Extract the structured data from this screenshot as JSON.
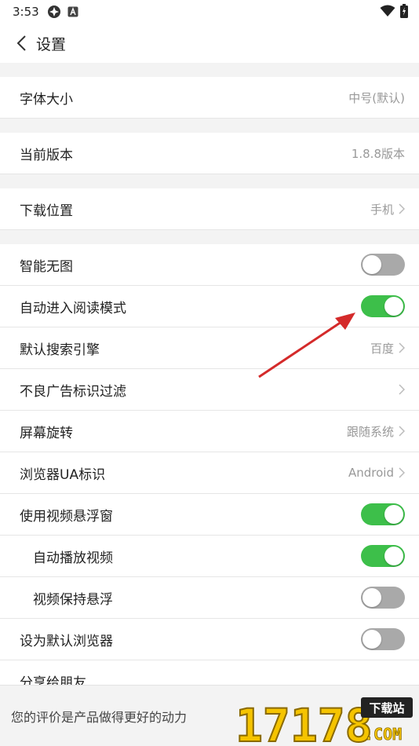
{
  "status_bar": {
    "time": "3:53"
  },
  "header": {
    "title": "设置"
  },
  "settings": {
    "font_size": {
      "label": "字体大小",
      "value": "中号(默认)"
    },
    "version": {
      "label": "当前版本",
      "value": "1.8.8版本"
    },
    "download_location": {
      "label": "下载位置",
      "value": "手机"
    },
    "smart_no_image": {
      "label": "智能无图",
      "toggle": "off"
    },
    "auto_reading_mode": {
      "label": "自动进入阅读模式",
      "toggle": "on"
    },
    "search_engine": {
      "label": "默认搜索引擎",
      "value": "百度"
    },
    "ad_filter": {
      "label": "不良广告标识过滤",
      "value": ""
    },
    "screen_rotation": {
      "label": "屏幕旋转",
      "value": "跟随系统"
    },
    "ua": {
      "label": "浏览器UA标识",
      "value": "Android"
    },
    "floating_video": {
      "label": "使用视频悬浮窗",
      "toggle": "on"
    },
    "autoplay_video": {
      "label": "自动播放视频",
      "toggle": "on"
    },
    "keep_floating": {
      "label": "视频保持悬浮",
      "toggle": "off"
    },
    "default_browser": {
      "label": "设为默认浏览器",
      "toggle": "off"
    },
    "share": {
      "label": "分享给朋友"
    }
  },
  "bottom": {
    "prompt": "您的评价是产品做得更好的动力"
  },
  "watermark": {
    "text": "17178",
    "badge": "下载站",
    "domain": ".COM"
  },
  "colors": {
    "toggle_on": "#3dbf4a",
    "toggle_off": "#a9a9a9",
    "arrow": "#d42a2a",
    "watermark_yellow": "#f5c400"
  }
}
